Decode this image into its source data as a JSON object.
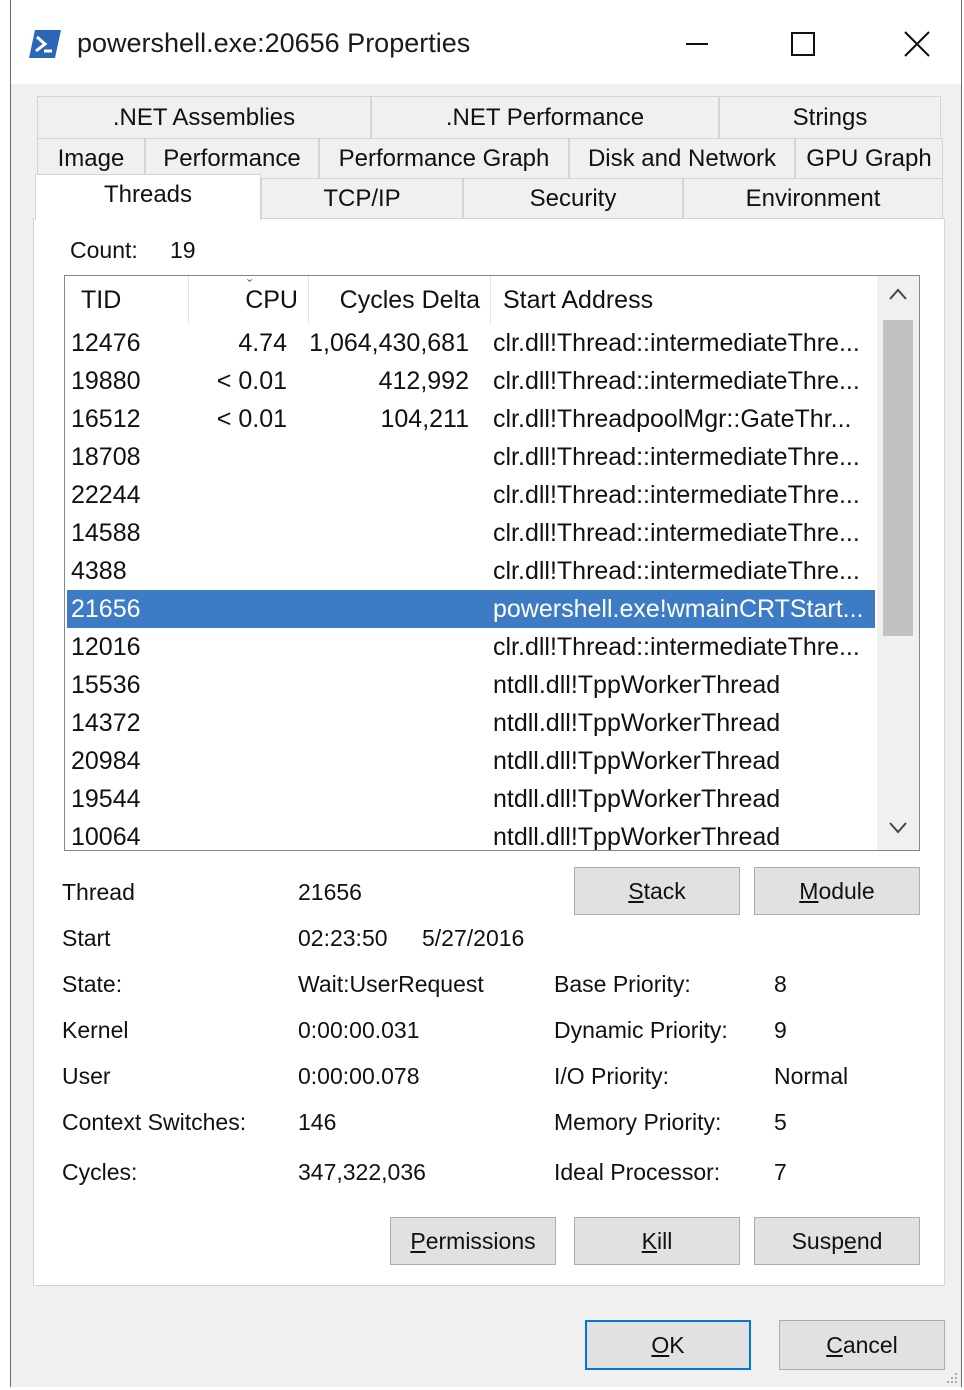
{
  "window": {
    "title": "powershell.exe:20656 Properties",
    "controls": [
      "minimize",
      "maximize",
      "close"
    ]
  },
  "tabs": {
    "row1": [
      ".NET Assemblies",
      ".NET Performance",
      "Strings"
    ],
    "row2": [
      "Image",
      "Performance",
      "Performance Graph",
      "Disk and Network",
      "GPU Graph"
    ],
    "row3": [
      "Threads",
      "TCP/IP",
      "Security",
      "Environment"
    ],
    "active": "Threads"
  },
  "threads": {
    "count_label": "Count:",
    "count_value": "19",
    "columns": [
      "TID",
      "CPU",
      "Cycles Delta",
      "Start Address"
    ],
    "sorted_column": "CPU",
    "rows": [
      {
        "tid": "12476",
        "cpu": "4.74",
        "cycles": "1,064,430,681",
        "addr": "clr.dll!Thread::intermediateThre..."
      },
      {
        "tid": "19880",
        "cpu": "< 0.01",
        "cycles": "412,992",
        "addr": "clr.dll!Thread::intermediateThre..."
      },
      {
        "tid": "16512",
        "cpu": "< 0.01",
        "cycles": "104,211",
        "addr": "clr.dll!ThreadpoolMgr::GateThr..."
      },
      {
        "tid": "18708",
        "cpu": "",
        "cycles": "",
        "addr": "clr.dll!Thread::intermediateThre..."
      },
      {
        "tid": "22244",
        "cpu": "",
        "cycles": "",
        "addr": "clr.dll!Thread::intermediateThre..."
      },
      {
        "tid": "14588",
        "cpu": "",
        "cycles": "",
        "addr": "clr.dll!Thread::intermediateThre..."
      },
      {
        "tid": "4388",
        "cpu": "",
        "cycles": "",
        "addr": "clr.dll!Thread::intermediateThre..."
      },
      {
        "tid": "21656",
        "cpu": "",
        "cycles": "",
        "addr": "powershell.exe!wmainCRTStart..."
      },
      {
        "tid": "12016",
        "cpu": "",
        "cycles": "",
        "addr": "clr.dll!Thread::intermediateThre..."
      },
      {
        "tid": "15536",
        "cpu": "",
        "cycles": "",
        "addr": "ntdll.dll!TppWorkerThread"
      },
      {
        "tid": "14372",
        "cpu": "",
        "cycles": "",
        "addr": "ntdll.dll!TppWorkerThread"
      },
      {
        "tid": "20984",
        "cpu": "",
        "cycles": "",
        "addr": "ntdll.dll!TppWorkerThread"
      },
      {
        "tid": "19544",
        "cpu": "",
        "cycles": "",
        "addr": "ntdll.dll!TppWorkerThread"
      },
      {
        "tid": "10064",
        "cpu": "",
        "cycles": "",
        "addr": "ntdll.dll!TppWorkerThread"
      }
    ],
    "selected_tid": "21656"
  },
  "details": {
    "thread_label": "Thread",
    "thread_value": "21656",
    "start_label": "Start",
    "start_time": "02:23:50",
    "start_date": "5/27/2016",
    "state_label": "State:",
    "state_value": "Wait:UserRequest",
    "kernel_label": "Kernel",
    "kernel_value": "0:00:00.031",
    "user_label": "User",
    "user_value": "0:00:00.078",
    "ctx_label": "Context Switches:",
    "ctx_value": "146",
    "cycles_label": "Cycles:",
    "cycles_value": "347,322,036",
    "base_prio_label": "Base Priority:",
    "base_prio_value": "8",
    "dyn_prio_label": "Dynamic Priority:",
    "dyn_prio_value": "9",
    "io_prio_label": "I/O Priority:",
    "io_prio_value": "Normal",
    "mem_prio_label": "Memory Priority:",
    "mem_prio_value": "5",
    "ideal_proc_label": "Ideal Processor:",
    "ideal_proc_value": "7"
  },
  "buttons": {
    "stack": {
      "pre": "",
      "acc": "S",
      "post": "tack"
    },
    "module": {
      "pre": "",
      "acc": "M",
      "post": "odule"
    },
    "permissions": {
      "pre": "",
      "acc": "P",
      "post": "ermissions"
    },
    "kill": {
      "pre": "",
      "acc": "K",
      "post": "ill"
    },
    "suspend": {
      "pre": "Susp",
      "acc": "e",
      "post": "nd"
    },
    "ok": {
      "pre": "",
      "acc": "O",
      "post": "K"
    },
    "cancel": {
      "pre": "",
      "acc": "C",
      "post": "ancel"
    }
  },
  "colors": {
    "selection": "#3d7cc4",
    "default_button_border": "#0078d7",
    "powershell_icon": "#2b67b7"
  }
}
